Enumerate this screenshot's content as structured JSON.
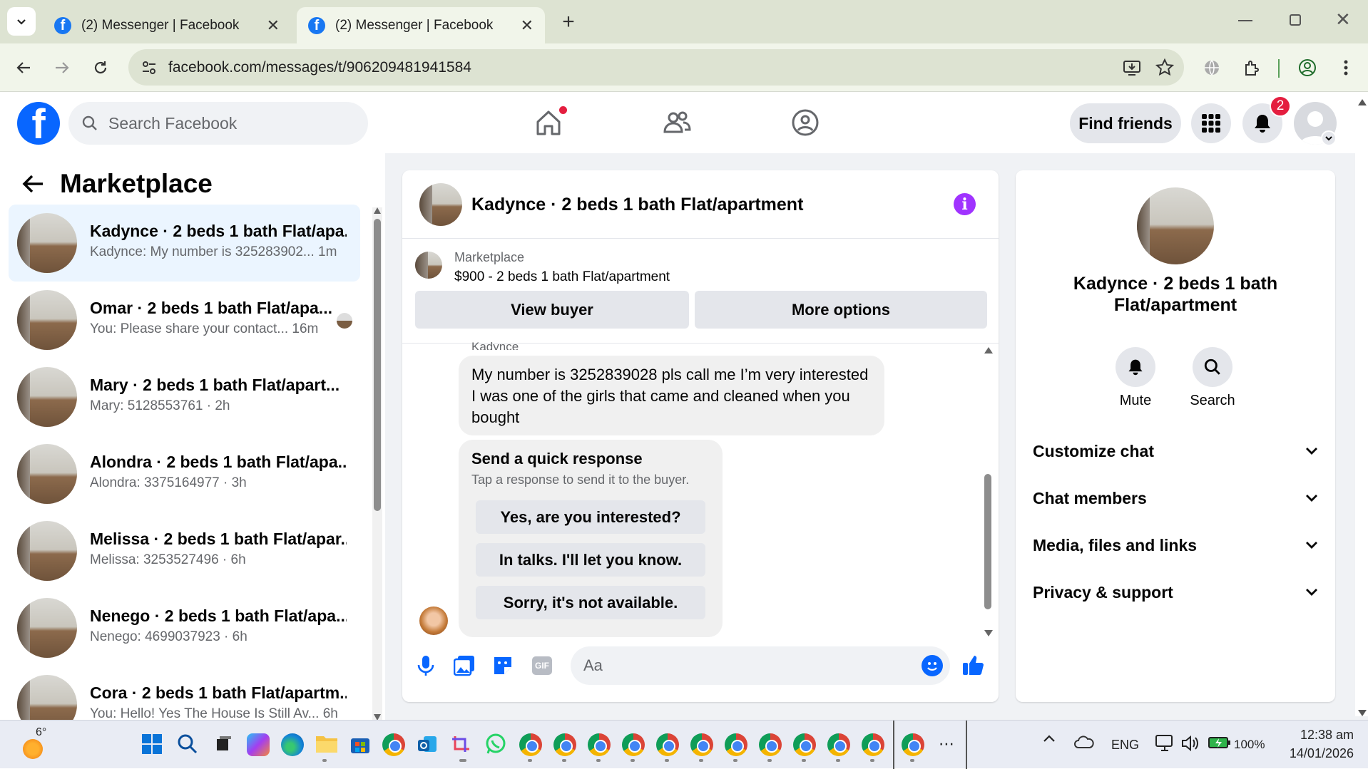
{
  "browser": {
    "tabs": [
      {
        "title": "(2) Messenger | Facebook",
        "active": false
      },
      {
        "title": "(2) Messenger | Facebook",
        "active": true
      }
    ],
    "url": "facebook.com/messages/t/906209481941584"
  },
  "fb_header": {
    "search_placeholder": "Search Facebook",
    "find_friends_label": "Find friends",
    "notification_count": "2"
  },
  "left_panel": {
    "title": "Marketplace",
    "conversations": [
      {
        "name": "Kadynce · 2 beds 1 bath Flat/apa...",
        "preview": "Kadynce: My number is 325283902... 1m",
        "active": true
      },
      {
        "name": "Omar · 2 beds 1 bath Flat/apa...",
        "preview": "You: Please share your contact... 16m",
        "active": false
      },
      {
        "name": "Mary · 2 beds 1 bath Flat/apart...",
        "preview": "Mary: 5128553761 · 2h",
        "active": false
      },
      {
        "name": "Alondra · 2 beds 1 bath Flat/apa...",
        "preview": "Alondra: 3375164977 · 3h",
        "active": false
      },
      {
        "name": "Melissa · 2 beds 1 bath Flat/apar...",
        "preview": "Melissa: 3253527496 · 6h",
        "active": false
      },
      {
        "name": "Nenego · 2 beds 1 bath Flat/apa...",
        "preview": "Nenego: 4699037923 · 6h",
        "active": false
      },
      {
        "name": "Cora · 2 beds 1 bath Flat/apartm...",
        "preview": "You: Hello! Yes The House Is Still Av... 6h",
        "active": false
      }
    ]
  },
  "chat": {
    "title": "Kadynce · 2 beds 1 bath Flat/apartment",
    "listing_source": "Marketplace",
    "listing_title": "$900 - 2 beds 1 bath Flat/apartment",
    "view_buyer_label": "View buyer",
    "more_options_label": "More options",
    "sender_name": "Kadynce",
    "message_text": "My number is 3252839028 pls call me I’m very interested I was one of the girls that came and cleaned when you bought",
    "quick_response": {
      "title": "Send a quick response",
      "subtitle": "Tap a response to send it to the buyer.",
      "options": [
        "Yes, are you interested?",
        "In talks. I'll let you know.",
        "Sorry, it's not available."
      ]
    },
    "input_placeholder": "Aa"
  },
  "right_panel": {
    "name": "Kadynce · 2 beds 1 bath Flat/apartment",
    "mute_label": "Mute",
    "search_label": "Search",
    "sections": [
      "Customize chat",
      "Chat members",
      "Media, files and links",
      "Privacy & support"
    ]
  },
  "taskbar": {
    "weather_temp": "6°",
    "language": "ENG",
    "battery": "100%",
    "time": "12:38 am",
    "date": "14/01/2026"
  },
  "colors": {
    "facebook_blue": "#0866ff",
    "notification_red": "#e41e3f",
    "info_purple": "#a033ff",
    "active_conversation_bg": "#ebf5ff"
  }
}
